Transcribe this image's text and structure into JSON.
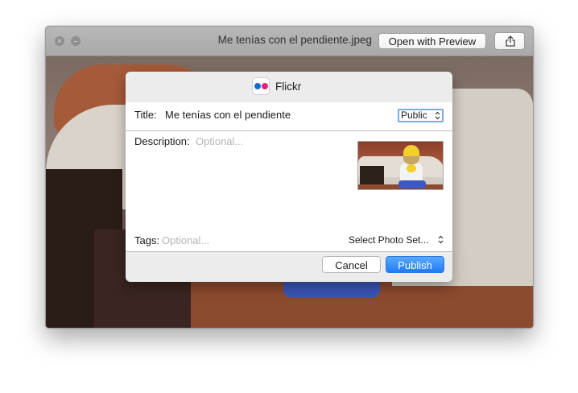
{
  "window": {
    "title": "Me tenías con el pendiente.jpeg",
    "open_button_label": "Open with Preview",
    "close_glyph": "×",
    "minimize_glyph": "–",
    "share_icon": "share-icon"
  },
  "sheet": {
    "service_name": "Flickr",
    "logo_icon": "flickr-icon",
    "title_label": "Title:",
    "title_value": "Me tenías con el pendiente",
    "privacy_value": "Public",
    "description_label": "Description:",
    "description_placeholder": "Optional...",
    "tags_label": "Tags:",
    "tags_placeholder": "Optional...",
    "photo_set_value": "Select Photo Set...",
    "cancel_label": "Cancel",
    "publish_label": "Publish"
  },
  "colors": {
    "accent": "#1f7cf5",
    "flickr_blue": "#1a6ad6",
    "flickr_pink": "#ef1d7b"
  }
}
